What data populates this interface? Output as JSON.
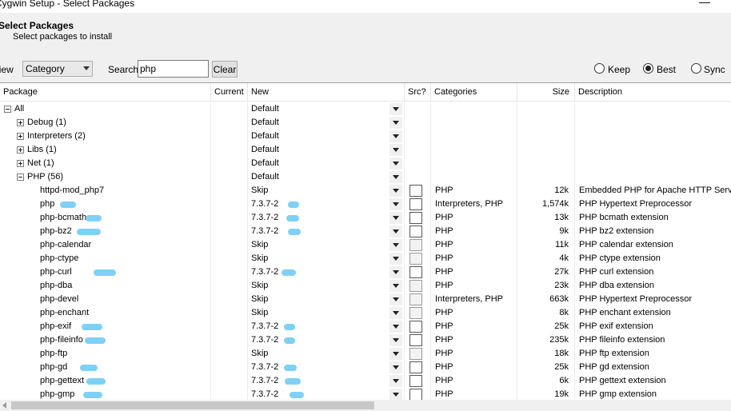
{
  "window": {
    "title": "Cygwin Setup - Select Packages",
    "close_glyph": "—"
  },
  "header": {
    "title": "Select Packages",
    "subtitle": "Select packages to install"
  },
  "toolbar": {
    "view_label": "View",
    "view_value": "Category",
    "search_label": "Search",
    "search_value": "php",
    "clear_label": "Clear",
    "radios": [
      {
        "label": "Keep",
        "checked": false
      },
      {
        "label": "Best",
        "checked": true
      },
      {
        "label": "Sync",
        "checked": false
      }
    ]
  },
  "columns": [
    "Package",
    "Current",
    "New",
    "Src?",
    "Categories",
    "Size",
    "Description"
  ],
  "tree_rows": [
    {
      "label": "All",
      "expander": "minus",
      "new": "Default"
    },
    {
      "label": "Debug (1)",
      "expander": "plus",
      "new": "Default"
    },
    {
      "label": "Interpreters (2)",
      "expander": "plus",
      "new": "Default"
    },
    {
      "label": "Libs (1)",
      "expander": "plus",
      "new": "Default"
    },
    {
      "label": "Net (1)",
      "expander": "plus",
      "new": "Default"
    },
    {
      "label": "PHP (56)",
      "expander": "minus",
      "new": "Default"
    }
  ],
  "packages": [
    {
      "name": "httpd-mod_php7",
      "current": "",
      "new": "Skip",
      "src_disabled": false,
      "categories": "PHP",
      "size": "12k",
      "description": "Embedded PHP for Apache HTTP Server"
    },
    {
      "name": "php",
      "current": "",
      "new": "7.3.7-2",
      "src_disabled": false,
      "categories": "Interpreters, PHP",
      "size": "1,574k",
      "description": "PHP Hypertext Preprocessor"
    },
    {
      "name": "php-bcmath",
      "current": "",
      "new": "7.3.7-2",
      "src_disabled": false,
      "categories": "PHP",
      "size": "13k",
      "description": "PHP bcmath extension"
    },
    {
      "name": "php-bz2",
      "current": "",
      "new": "7.3.7-2",
      "src_disabled": false,
      "categories": "PHP",
      "size": "9k",
      "description": "PHP bz2 extension"
    },
    {
      "name": "php-calendar",
      "current": "",
      "new": "Skip",
      "src_disabled": true,
      "categories": "PHP",
      "size": "11k",
      "description": "PHP calendar extension"
    },
    {
      "name": "php-ctype",
      "current": "",
      "new": "Skip",
      "src_disabled": true,
      "categories": "PHP",
      "size": "4k",
      "description": "PHP ctype extension"
    },
    {
      "name": "php-curl",
      "current": "",
      "new": "7.3.7-2",
      "src_disabled": false,
      "categories": "PHP",
      "size": "27k",
      "description": "PHP curl extension"
    },
    {
      "name": "php-dba",
      "current": "",
      "new": "Skip",
      "src_disabled": true,
      "categories": "PHP",
      "size": "23k",
      "description": "PHP dba extension"
    },
    {
      "name": "php-devel",
      "current": "",
      "new": "Skip",
      "src_disabled": true,
      "categories": "Interpreters, PHP",
      "size": "663k",
      "description": "PHP Hypertext Preprocessor"
    },
    {
      "name": "php-enchant",
      "current": "",
      "new": "Skip",
      "src_disabled": true,
      "categories": "PHP",
      "size": "8k",
      "description": "PHP enchant extension"
    },
    {
      "name": "php-exif",
      "current": "",
      "new": "7.3.7-2",
      "src_disabled": false,
      "categories": "PHP",
      "size": "25k",
      "description": "PHP exif extension"
    },
    {
      "name": "php-fileinfo",
      "current": "",
      "new": "7.3.7-2",
      "src_disabled": false,
      "categories": "PHP",
      "size": "235k",
      "description": "PHP fileinfo extension"
    },
    {
      "name": "php-ftp",
      "current": "",
      "new": "Skip",
      "src_disabled": true,
      "categories": "PHP",
      "size": "18k",
      "description": "PHP ftp extension"
    },
    {
      "name": "php-gd",
      "current": "",
      "new": "7.3.7-2",
      "src_disabled": false,
      "categories": "PHP",
      "size": "25k",
      "description": "PHP gd extension"
    },
    {
      "name": "php-gettext",
      "current": "",
      "new": "7.3.7-2",
      "src_disabled": false,
      "categories": "PHP",
      "size": "6k",
      "description": "PHP gettext extension"
    },
    {
      "name": "php-gmp",
      "current": "",
      "new": "7.3.7-2",
      "src_disabled": false,
      "categories": "PHP",
      "size": "19k",
      "description": "PHP gmp extension"
    }
  ],
  "colors": {
    "selection_blob": "#7fd0f5",
    "panel_bg": "#f0f0f0"
  }
}
